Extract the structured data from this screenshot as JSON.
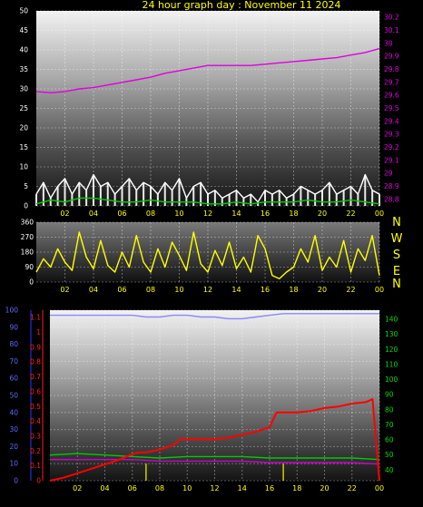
{
  "title": "24 hour graph day : November 11 2024",
  "colors": {
    "title": "#ffff00",
    "wind_axis": "#ffffff",
    "pressure": "#e000e0",
    "gust": "#ffffff",
    "wind_avg": "#00cc00",
    "direction": "#ffff00",
    "compass": "#ffff00",
    "rain": "#ff0000",
    "rain_axis": "#ff2020",
    "humidity": "#8888ff",
    "humidity_axis": "#6666ff",
    "temp": "#00cc00",
    "dew": "#cc00cc",
    "solar": "#cccc00",
    "temp_axis": "#00dd00"
  },
  "compass": [
    "N",
    "W",
    "S",
    "E",
    "N"
  ],
  "chart_data": [
    {
      "type": "line",
      "name": "wind-pressure",
      "x_ticks": [
        "02",
        "04",
        "06",
        "08",
        "10",
        "12",
        "14",
        "16",
        "18",
        "20",
        "22",
        "00"
      ],
      "y_left": {
        "ticks": [
          "0",
          "5",
          "10",
          "15",
          "20",
          "25",
          "30",
          "35",
          "40",
          "45",
          "50"
        ],
        "range": [
          0,
          50
        ]
      },
      "y_right": {
        "ticks": [
          "28.8",
          "28.9",
          "29",
          "29.1",
          "29.2",
          "29.3",
          "29.4",
          "29.5",
          "29.6",
          "29.7",
          "29.8",
          "29.9",
          "30",
          "30.1",
          "30.2"
        ],
        "range": [
          28.75,
          30.25
        ]
      },
      "series": [
        {
          "key": "pressure",
          "axis": "right",
          "x": [
            0,
            1,
            2,
            3,
            4,
            5,
            6,
            7,
            8,
            9,
            10,
            11,
            12,
            13,
            14,
            15,
            16,
            17,
            18,
            19,
            20,
            21,
            22,
            23,
            24
          ],
          "values": [
            29.63,
            29.62,
            29.63,
            29.65,
            29.66,
            29.68,
            29.7,
            29.72,
            29.74,
            29.77,
            29.79,
            29.81,
            29.83,
            29.83,
            29.83,
            29.83,
            29.84,
            29.85,
            29.86,
            29.87,
            29.88,
            29.89,
            29.91,
            29.93,
            29.96
          ]
        },
        {
          "key": "gust",
          "axis": "left",
          "x": [
            0,
            0.5,
            1,
            1.5,
            2,
            2.5,
            3,
            3.5,
            4,
            4.5,
            5,
            5.5,
            6,
            6.5,
            7,
            7.5,
            8,
            8.5,
            9,
            9.5,
            10,
            10.5,
            11,
            11.5,
            12,
            12.5,
            13,
            13.5,
            14,
            14.5,
            15,
            15.5,
            16,
            16.5,
            17,
            17.5,
            18,
            18.5,
            19,
            19.5,
            20,
            20.5,
            21,
            21.5,
            22,
            22.5,
            23,
            23.5,
            24
          ],
          "values": [
            3,
            6,
            2,
            5,
            7,
            3,
            6,
            4,
            8,
            5,
            6,
            3,
            5,
            7,
            4,
            6,
            5,
            3,
            6,
            4,
            7,
            2,
            5,
            6,
            3,
            4,
            2,
            3,
            4,
            2,
            3,
            1,
            4,
            3,
            4,
            2,
            3,
            5,
            4,
            3,
            4,
            6,
            3,
            4,
            5,
            3,
            8,
            4,
            3
          ]
        },
        {
          "key": "wind_avg",
          "axis": "left",
          "x": [
            0,
            1,
            2,
            3,
            4,
            5,
            6,
            7,
            8,
            9,
            10,
            11,
            12,
            13,
            14,
            15,
            16,
            17,
            18,
            19,
            20,
            21,
            22,
            23,
            24
          ],
          "values": [
            0.5,
            1.5,
            1,
            2,
            2,
            1.5,
            1,
            1,
            1.5,
            1,
            1,
            1,
            0.5,
            0.5,
            1,
            0.5,
            1,
            1,
            1,
            1.5,
            1,
            1,
            1.5,
            1,
            0.5
          ]
        }
      ]
    },
    {
      "type": "line",
      "name": "wind-direction",
      "x_ticks": [
        "02",
        "04",
        "06",
        "08",
        "10",
        "12",
        "14",
        "16",
        "18",
        "20",
        "22",
        "00"
      ],
      "y_left": {
        "ticks": [
          "0",
          "90",
          "180",
          "270",
          "360"
        ],
        "range": [
          0,
          360
        ]
      },
      "series": [
        {
          "key": "direction",
          "x": [
            0,
            0.5,
            1,
            1.5,
            2,
            2.5,
            3,
            3.5,
            4,
            4.5,
            5,
            5.5,
            6,
            6.5,
            7,
            7.5,
            8,
            8.5,
            9,
            9.5,
            10,
            10.5,
            11,
            11.5,
            12,
            12.5,
            13,
            13.5,
            14,
            14.5,
            15,
            15.5,
            16,
            16.5,
            17,
            17.5,
            18,
            18.5,
            19,
            19.5,
            20,
            20.5,
            21,
            21.5,
            22,
            22.5,
            23,
            23.5,
            24
          ],
          "values": [
            60,
            140,
            90,
            200,
            120,
            70,
            300,
            150,
            80,
            250,
            100,
            60,
            180,
            90,
            280,
            120,
            60,
            200,
            90,
            240,
            160,
            70,
            300,
            110,
            60,
            190,
            100,
            240,
            80,
            150,
            60,
            280,
            200,
            40,
            20,
            60,
            90,
            200,
            120,
            280,
            70,
            150,
            90,
            250,
            60,
            200,
            130,
            280,
            40
          ]
        }
      ]
    },
    {
      "type": "line",
      "name": "rain-temp-humidity",
      "x_ticks": [
        "02",
        "04",
        "06",
        "08",
        "10",
        "12",
        "14",
        "16",
        "18",
        "20",
        "22",
        "00"
      ],
      "y_left_outer": {
        "ticks": [
          "0",
          "10",
          "20",
          "30",
          "40",
          "50",
          "60",
          "70",
          "80",
          "90",
          "100"
        ],
        "range": [
          0,
          100
        ]
      },
      "y_left_inner": {
        "ticks": [
          "0",
          "0.1",
          "0.2",
          "0.3",
          "0.4",
          "0.5",
          "0.6",
          "0.7",
          "0.8",
          "0.9",
          "1",
          "1.1"
        ],
        "range": [
          0,
          1.15
        ]
      },
      "y_right": {
        "ticks": [
          "40",
          "50",
          "60",
          "70",
          "80",
          "90",
          "100",
          "110",
          "120",
          "130",
          "140"
        ],
        "range": [
          33,
          146
        ]
      },
      "series": [
        {
          "key": "humidity",
          "axis": "left_outer",
          "x": [
            0,
            2,
            4,
            6,
            7,
            8,
            9,
            10,
            11,
            12,
            13,
            14,
            15,
            16,
            17,
            18,
            19,
            20,
            21,
            22,
            23,
            24
          ],
          "values": [
            97,
            97,
            97,
            97,
            96,
            96,
            97,
            97,
            96,
            96,
            95,
            95,
            96,
            97,
            98,
            98,
            98,
            98,
            98,
            98,
            98,
            98
          ]
        },
        {
          "key": "temp",
          "axis": "right",
          "x": [
            0,
            2,
            4,
            6,
            8,
            10,
            12,
            14,
            16,
            18,
            20,
            22,
            24
          ],
          "values": [
            50,
            51,
            50,
            49,
            48,
            49,
            49,
            49,
            48,
            48,
            48,
            48,
            47
          ]
        },
        {
          "key": "dew",
          "axis": "right",
          "x": [
            0,
            2,
            4,
            6,
            8,
            10,
            12,
            14,
            16,
            18,
            20,
            22,
            24
          ],
          "values": [
            47,
            47,
            47,
            47,
            46,
            46,
            46,
            46,
            45,
            45,
            45,
            45,
            44
          ]
        },
        {
          "key": "rain",
          "axis": "left_inner",
          "x": [
            0,
            1,
            2,
            3,
            4,
            5,
            6,
            6.5,
            7,
            8,
            9,
            9.5,
            10,
            11,
            12,
            13,
            14,
            15,
            16,
            16.5,
            17,
            18,
            19,
            20,
            21,
            22,
            23,
            23.5,
            24
          ],
          "values": [
            0.0,
            0.02,
            0.05,
            0.08,
            0.11,
            0.14,
            0.18,
            0.19,
            0.19,
            0.21,
            0.24,
            0.28,
            0.28,
            0.28,
            0.28,
            0.29,
            0.31,
            0.33,
            0.36,
            0.46,
            0.46,
            0.46,
            0.47,
            0.49,
            0.5,
            0.52,
            0.53,
            0.55,
            0.0
          ]
        },
        {
          "key": "solar",
          "axis": "left_outer",
          "x": [
            7,
            17
          ],
          "values": [
            10,
            10
          ]
        }
      ]
    }
  ]
}
